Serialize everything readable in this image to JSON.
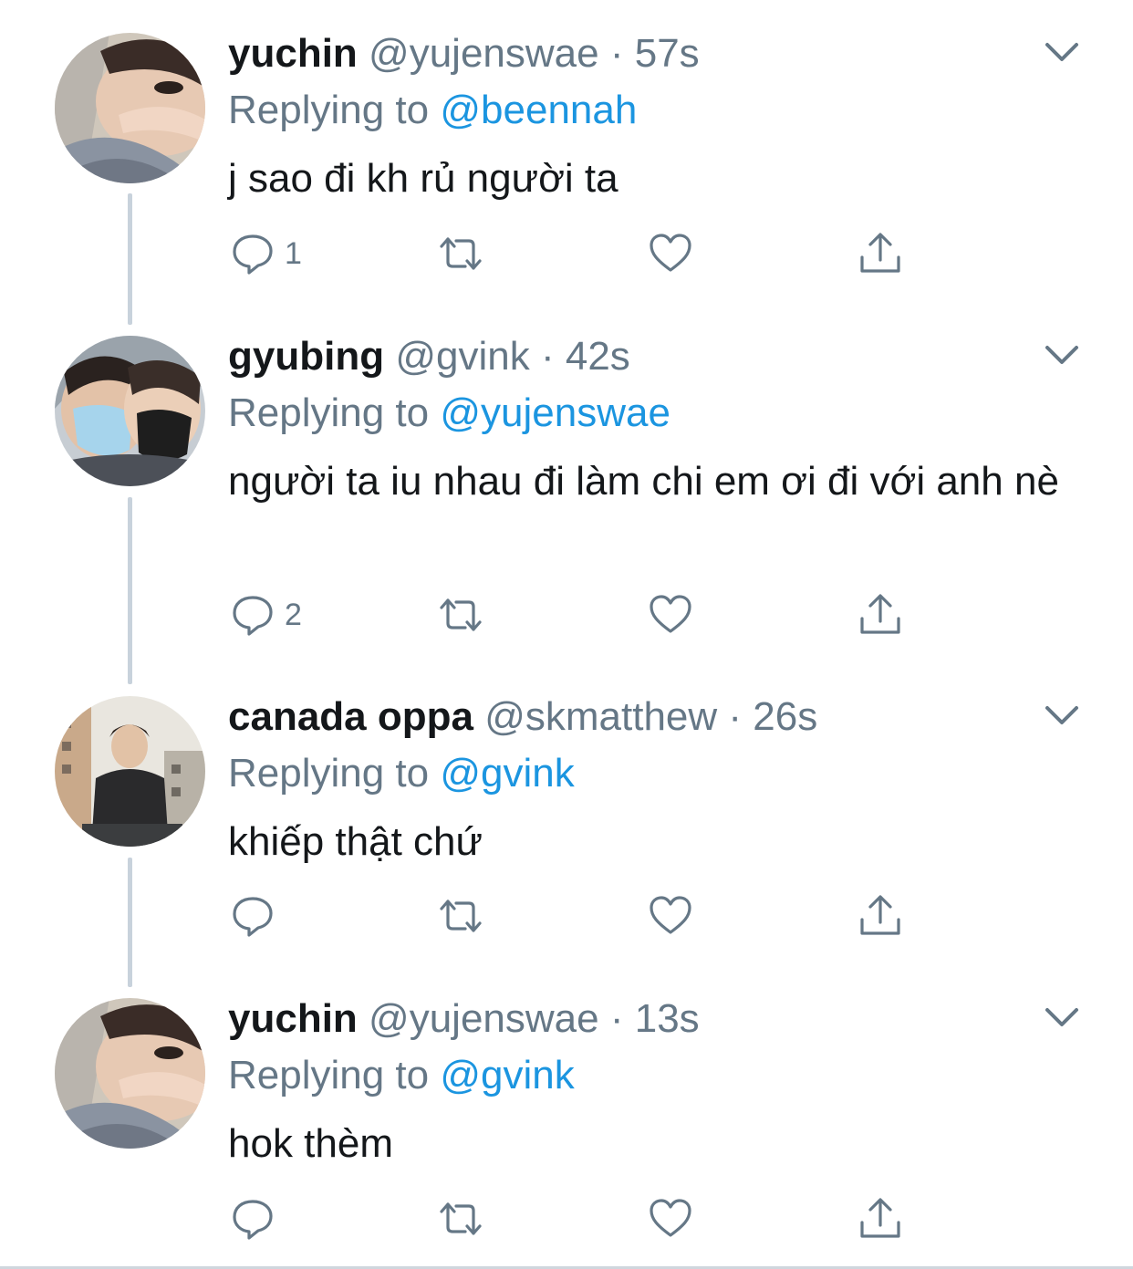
{
  "tweets": [
    {
      "display_name": "yuchin",
      "handle": "@yujenswae",
      "dot": "·",
      "time": "57s",
      "replying_label": "Replying to",
      "replying_to": "@beennah",
      "text": "j sao đi kh rủ người ta",
      "reply_count": "1",
      "avatar_icon": "avatar-photo"
    },
    {
      "display_name": "gyubing",
      "handle": "@gvink",
      "dot": "·",
      "time": "42s",
      "replying_label": "Replying to",
      "replying_to": "@yujenswae",
      "text": "người ta iu nhau đi làm chi em ơi đi với anh nè",
      "reply_count": "2",
      "avatar_icon": "avatar-photo"
    },
    {
      "display_name": "canada oppa",
      "handle": "@skmatthew",
      "dot": "·",
      "time": "26s",
      "replying_label": "Replying to",
      "replying_to": "@gvink",
      "text": "khiếp thật chứ",
      "reply_count": "",
      "avatar_icon": "avatar-photo"
    },
    {
      "display_name": "yuchin",
      "handle": "@yujenswae",
      "dot": "·",
      "time": "13s",
      "replying_label": "Replying to",
      "replying_to": "@gvink",
      "text": "hok thèm",
      "reply_count": "",
      "avatar_icon": "avatar-photo"
    }
  ],
  "icons": {
    "reply": "speech-bubble-icon",
    "retweet": "retweet-arrows-icon",
    "like": "heart-icon",
    "share": "upload-share-icon",
    "more": "chevron-down-icon"
  },
  "colors": {
    "name": "#14171a",
    "secondary": "#657786",
    "mention": "#1b95e0",
    "thread_line": "#c8d2dc"
  }
}
